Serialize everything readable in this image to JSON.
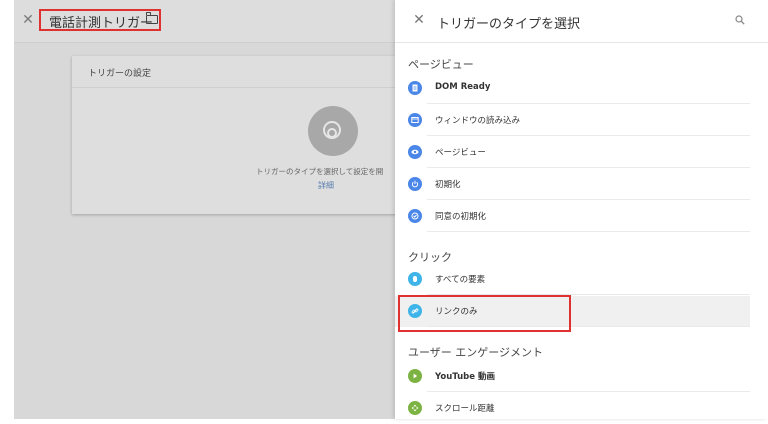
{
  "workspace": {
    "title": "電話計測トリガー",
    "card": {
      "title": "トリガーの設定",
      "description": "トリガーのタイプを選択して設定を開",
      "link": "詳細"
    }
  },
  "panel": {
    "title": "トリガーのタイプを選択",
    "sections": [
      {
        "label": "ページビュー",
        "items": [
          {
            "label": "DOM Ready",
            "icon": "document-icon",
            "color": "#4a87e8"
          },
          {
            "label": "ウィンドウの読み込み",
            "icon": "window-icon",
            "color": "#4a87e8"
          },
          {
            "label": "ページビュー",
            "icon": "eye-icon",
            "color": "#4a87e8"
          },
          {
            "label": "初期化",
            "icon": "power-icon",
            "color": "#4a87e8"
          },
          {
            "label": "同意の初期化",
            "icon": "consent-icon",
            "color": "#4a87e8"
          }
        ]
      },
      {
        "label": "クリック",
        "items": [
          {
            "label": "すべての要素",
            "icon": "cursor-icon",
            "color": "#3fb4e8"
          },
          {
            "label": "リンクのみ",
            "icon": "link-icon",
            "color": "#3fb4e8"
          }
        ]
      },
      {
        "label": "ユーザー エンゲージメント",
        "items": [
          {
            "label": "YouTube 動画",
            "icon": "play-icon",
            "color": "#7cb342"
          },
          {
            "label": "スクロール距離",
            "icon": "scroll-icon",
            "color": "#7cb342"
          }
        ]
      }
    ]
  }
}
